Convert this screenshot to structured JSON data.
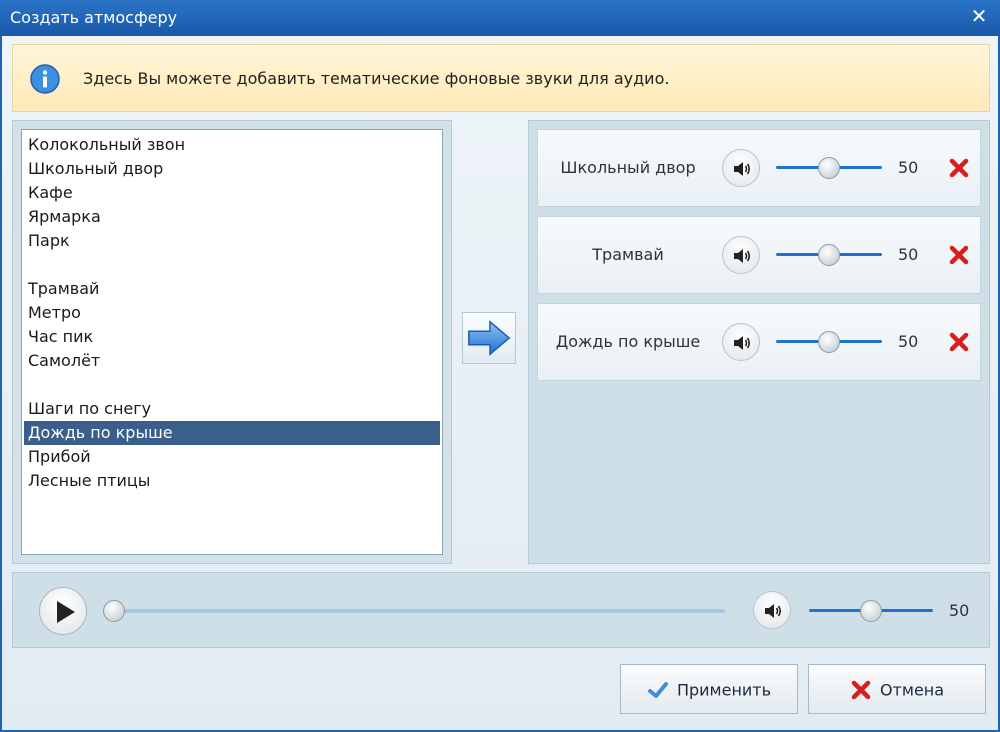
{
  "window": {
    "title": "Создать атмосферу",
    "close_icon": "close-icon"
  },
  "info": {
    "icon": "info-icon",
    "text": "Здесь Вы можете добавить тематические фоновые звуки для аудио."
  },
  "sound_list": {
    "items": [
      {
        "label": "Колокольный звон",
        "selected": false
      },
      {
        "label": "Школьный двор",
        "selected": false
      },
      {
        "label": "Кафе",
        "selected": false
      },
      {
        "label": "Ярмарка",
        "selected": false
      },
      {
        "label": "Парк",
        "selected": false
      },
      {
        "label": "",
        "selected": false
      },
      {
        "label": "Трамвай",
        "selected": false
      },
      {
        "label": "Метро",
        "selected": false
      },
      {
        "label": "Час пик",
        "selected": false
      },
      {
        "label": "Самолёт",
        "selected": false
      },
      {
        "label": "",
        "selected": false
      },
      {
        "label": "Шаги по снегу",
        "selected": false
      },
      {
        "label": "Дождь по крыше",
        "selected": true
      },
      {
        "label": "Прибой",
        "selected": false
      },
      {
        "label": "Лесные птицы",
        "selected": false
      }
    ]
  },
  "add_button_icon": "arrow-right-icon",
  "tracks": [
    {
      "name": "Школьный двор",
      "volume": 50,
      "volume_label": "50"
    },
    {
      "name": "Трамвай",
      "volume": 50,
      "volume_label": "50"
    },
    {
      "name": "Дождь по крыше",
      "volume": 50,
      "volume_label": "50"
    }
  ],
  "player": {
    "progress": 0,
    "volume": 50,
    "volume_label": "50"
  },
  "buttons": {
    "apply": "Применить",
    "cancel": "Отмена"
  },
  "colors": {
    "titlebar": "#1f63b5",
    "selection": "#3a5f8a",
    "slider": "#1f73d0",
    "remove": "#d81e1e"
  }
}
